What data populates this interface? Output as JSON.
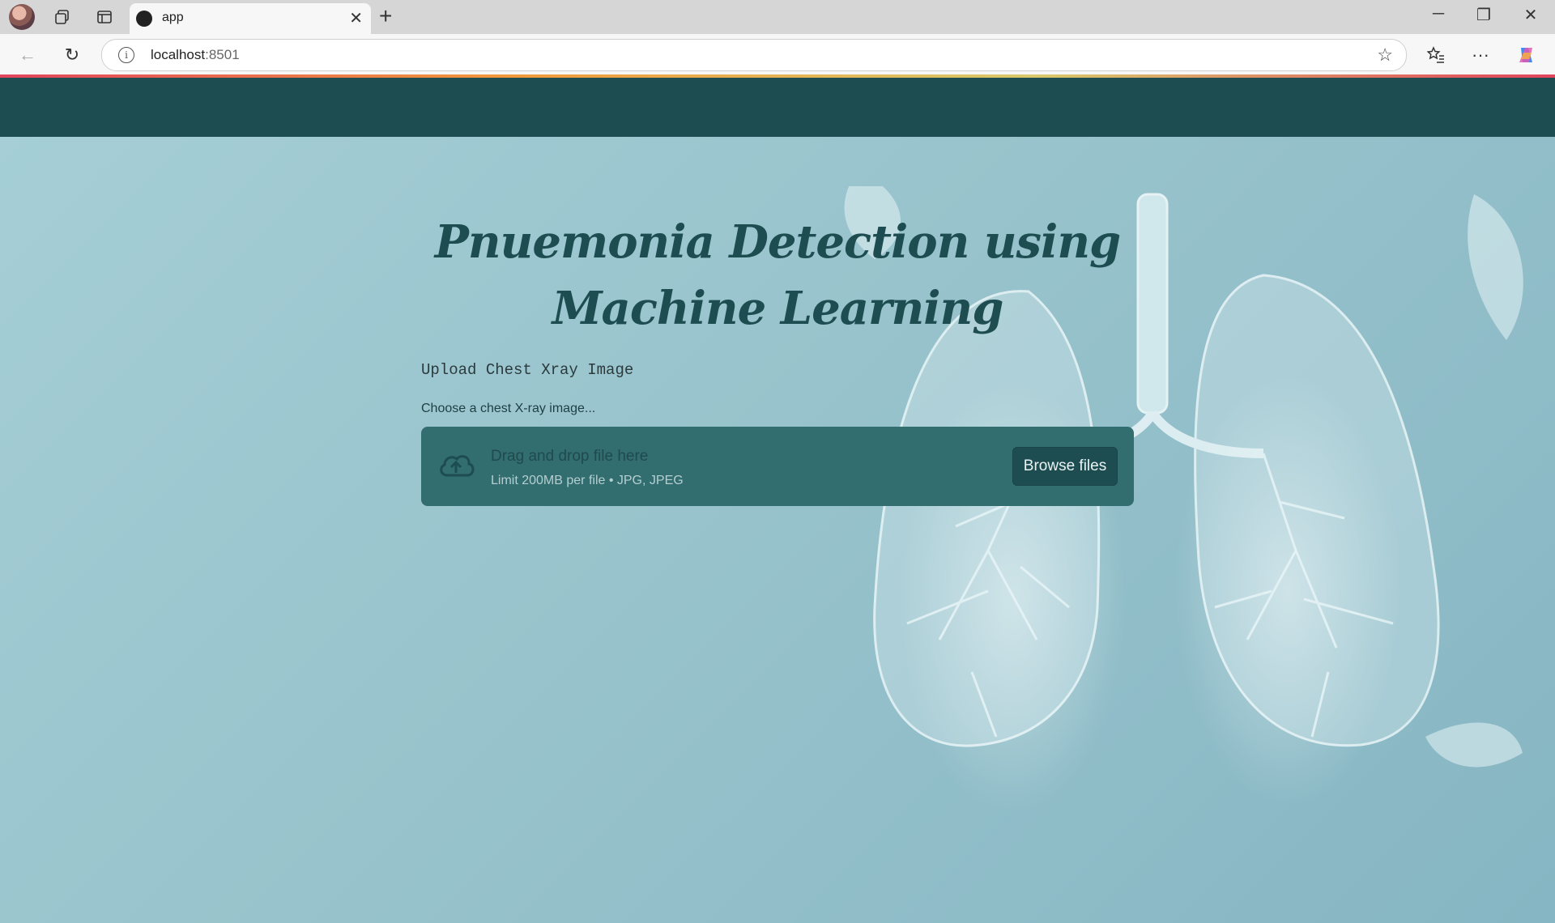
{
  "browser": {
    "tab_title": "app",
    "url_host": "localhost",
    "url_port": ":8501"
  },
  "app": {
    "title_line1": "Pnuemonia Detection using",
    "title_line2": "Machine Learning",
    "subheading": "Upload Chest Xray Image",
    "uploader": {
      "label": "Choose a chest X-ray image...",
      "drop_title": "Drag and drop file here",
      "limit_text": "Limit 200MB per file • JPG, JPEG",
      "browse_label": "Browse files"
    }
  },
  "colors": {
    "header": "#1d4d51",
    "dropzone": "#326d70",
    "title": "#1d4d51"
  }
}
